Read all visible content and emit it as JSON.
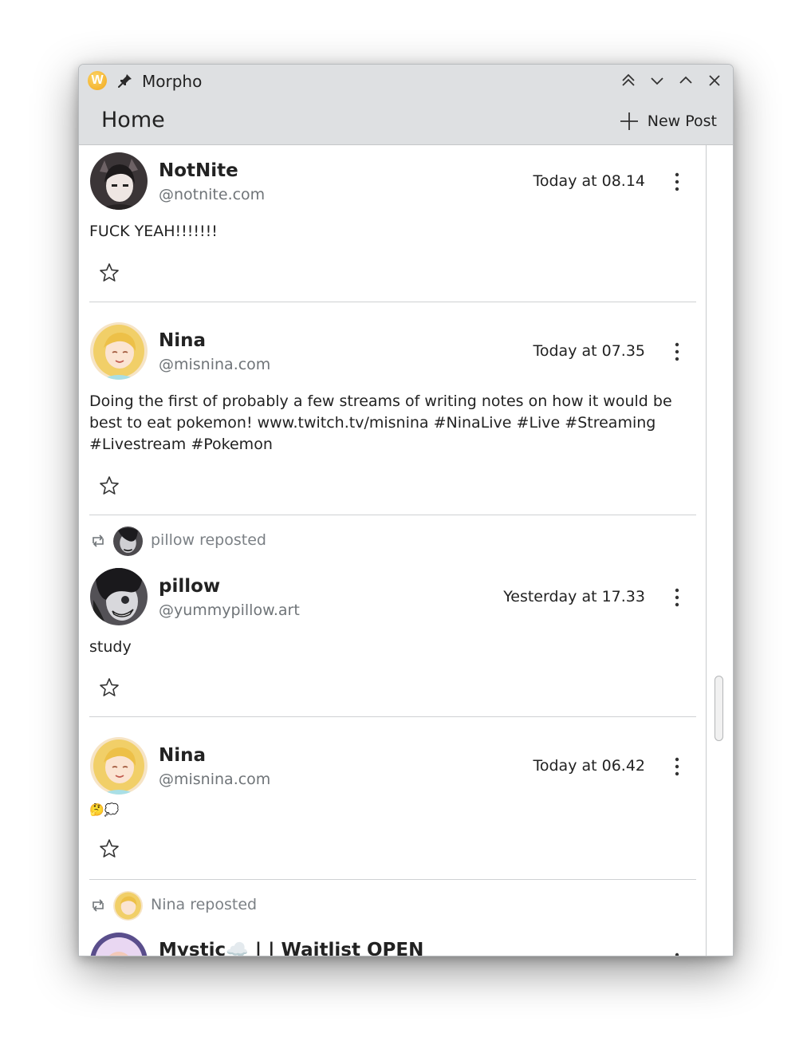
{
  "window": {
    "title": "Morpho",
    "app_icon_letter": "W"
  },
  "toolbar": {
    "page_title": "Home",
    "new_post_label": "New Post"
  },
  "feed": {
    "posts": [
      {
        "author": "NotNite",
        "handle": "@notnite.com",
        "time": "Today at 08.14",
        "text": "FUCK YEAH!!!!!!!"
      },
      {
        "author": "Nina",
        "handle": "@misnina.com",
        "time": "Today at 07.35",
        "text": "Doing the first of probably a few streams of writing notes on how it would be best to eat pokemon! www.twitch.tv/misnina #NinaLive #Live #Streaming #Livestream #Pokemon"
      },
      {
        "reposted_by": "pillow reposted",
        "author": "pillow",
        "handle": "@yummypillow.art",
        "time": "Yesterday at 17.33",
        "text": "study"
      },
      {
        "author": "Nina",
        "handle": "@misnina.com",
        "time": "Today at 06.42",
        "text": "🤔💭"
      },
      {
        "reposted_by": "Nina reposted",
        "author": "Mystic☁️ | | Waitlist OPEN"
      }
    ]
  },
  "colors": {
    "titlebar_bg": "#dee0e2",
    "muted_text": "#6f7478",
    "separator": "#cfd1d3"
  }
}
